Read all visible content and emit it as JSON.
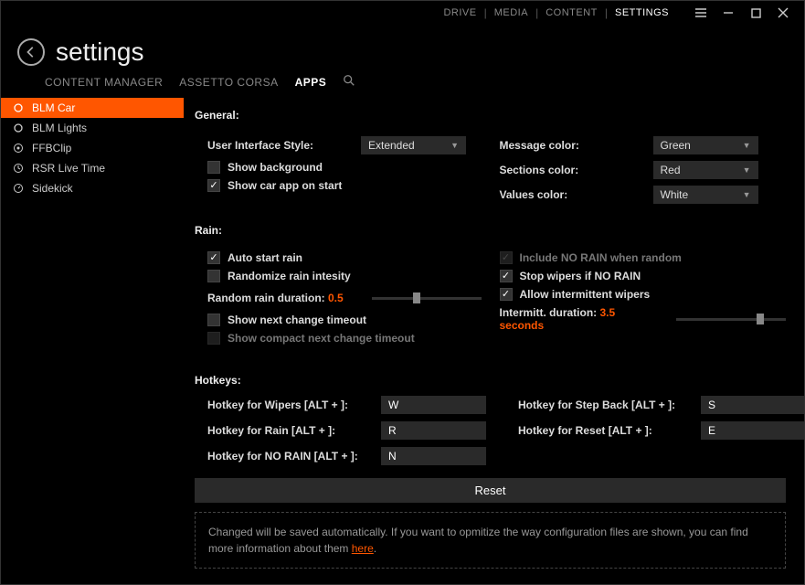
{
  "topnav": {
    "items": [
      "DRIVE",
      "MEDIA",
      "CONTENT",
      "SETTINGS"
    ],
    "active": 3
  },
  "header": {
    "title": "settings"
  },
  "tabs": {
    "items": [
      "CONTENT MANAGER",
      "ASSETTO CORSA",
      "APPS"
    ],
    "active": 2
  },
  "sidebar": {
    "items": [
      {
        "label": "BLM Car",
        "active": true
      },
      {
        "label": "BLM Lights"
      },
      {
        "label": "FFBClip"
      },
      {
        "label": "RSR Live Time"
      },
      {
        "label": "Sidekick"
      }
    ]
  },
  "general": {
    "title": "General:",
    "ui_style_label": "User Interface Style:",
    "ui_style_value": "Extended",
    "show_bg_label": "Show background",
    "show_bg_checked": false,
    "show_car_label": "Show car app on start",
    "show_car_checked": true,
    "message_color_label": "Message color:",
    "message_color_value": "Green",
    "sections_color_label": "Sections color:",
    "sections_color_value": "Red",
    "values_color_label": "Values color:",
    "values_color_value": "White"
  },
  "rain": {
    "title": "Rain:",
    "auto_start_label": "Auto start rain",
    "auto_start_checked": true,
    "randomize_label": "Randomize rain intesity",
    "randomize_checked": false,
    "random_duration_label": "Random rain duration: ",
    "random_duration_value": "0.5",
    "show_next_label": "Show next change timeout",
    "show_next_checked": false,
    "show_compact_label": "Show compact next change timeout",
    "show_compact_checked": false,
    "include_no_rain_label": "Include NO RAIN when random",
    "include_no_rain_checked": true,
    "stop_wipers_label": "Stop wipers if NO RAIN",
    "stop_wipers_checked": true,
    "allow_intermittent_label": "Allow intermittent wipers",
    "allow_intermittent_checked": true,
    "intermitt_label": "Intermitt. duration: ",
    "intermitt_value": "3.5 seconds"
  },
  "hotkeys": {
    "title": "Hotkeys:",
    "wipers_label": "Hotkey for Wipers [ALT + ]:",
    "wipers_value": "W",
    "rain_label": "Hotkey for Rain [ALT + ]:",
    "rain_value": "R",
    "norain_label": "Hotkey for NO RAIN [ALT + ]:",
    "norain_value": "N",
    "stepback_label": "Hotkey for Step Back [ALT + ]:",
    "stepback_value": "S",
    "reset_label": "Hotkey for Reset [ALT + ]:",
    "reset_value": "E"
  },
  "reset_button": "Reset",
  "info": {
    "text": "Changed will be saved automatically. If you want to opmitize the way configuration files are shown, you can find more information about them ",
    "link": "here"
  }
}
